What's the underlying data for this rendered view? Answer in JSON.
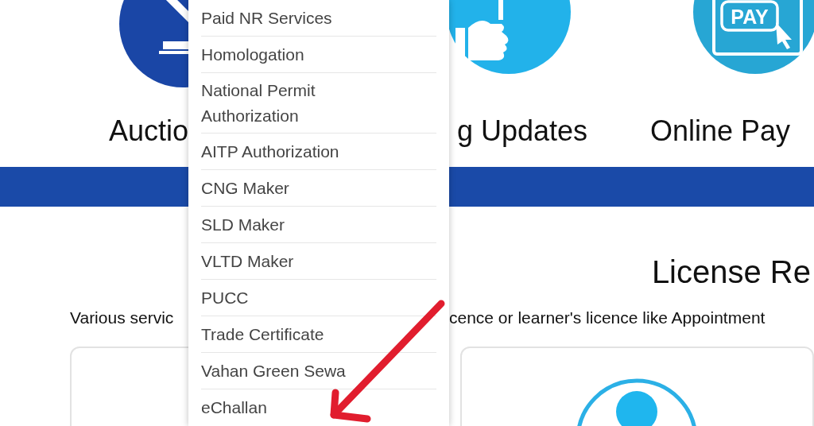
{
  "features": [
    {
      "kind": "auction",
      "label": "Auctio"
    },
    {
      "kind": "updates",
      "label": "g Updates"
    },
    {
      "kind": "payment",
      "label": "Online Pay",
      "icon_text": "PAY"
    }
  ],
  "section": {
    "title": "License Re",
    "description_left": "Various servic",
    "description_right": "cence or learner's licence like Appointment"
  },
  "menu": {
    "items": [
      {
        "label": "Paid NR Services"
      },
      {
        "label": "Homologation"
      },
      {
        "label": "National Permit Authorization"
      },
      {
        "label": "AITP Authorization"
      },
      {
        "label": "CNG Maker"
      },
      {
        "label": "SLD Maker"
      },
      {
        "label": "VLTD Maker"
      },
      {
        "label": "PUCC"
      },
      {
        "label": "Trade Certificate"
      },
      {
        "label": "Vahan Green Sewa"
      },
      {
        "label": "eChallan"
      }
    ]
  }
}
